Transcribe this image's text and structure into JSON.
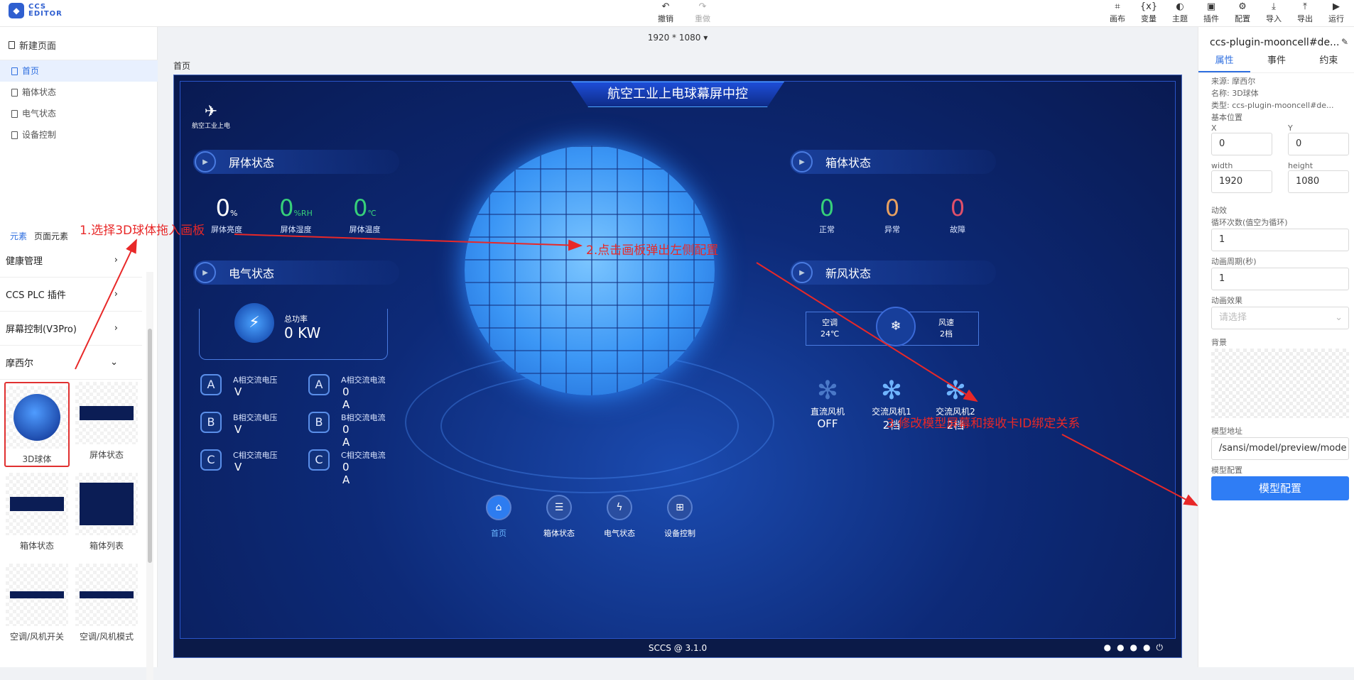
{
  "app": {
    "logo_line1": "CCS",
    "logo_line2": "EDITOR"
  },
  "toolbar": {
    "undo": "撤销",
    "redo": "重做",
    "tools": [
      "画布",
      "变量",
      "主题",
      "插件",
      "配置",
      "导入",
      "导出",
      "运行"
    ]
  },
  "left": {
    "new_page": "新建页面",
    "pages": [
      "首页",
      "箱体状态",
      "电气状态",
      "设备控制"
    ],
    "elem_tabs": [
      "元素",
      "页面元素"
    ],
    "categories": [
      "健康管理",
      "CCS PLC 插件",
      "屏幕控制(V3Pro)",
      "摩西尔"
    ],
    "components": [
      "3D球体",
      "屏体状态",
      "箱体状态",
      "箱体列表",
      "空调/风机开关",
      "空调/风机模式"
    ]
  },
  "center": {
    "resolution": "1920 * 1080",
    "breadcrumb": "首页",
    "footer": "SCCS @ 3.1.0"
  },
  "screen": {
    "title": "航空工业上电球幕屏中控",
    "brand": "航空工业上电",
    "sections": {
      "screen": "屏体状态",
      "electric": "电气状态",
      "box": "箱体状态",
      "fresh": "新风状态"
    },
    "screen_metrics": [
      {
        "value": "0",
        "unit": "%",
        "label": "屏体亮度"
      },
      {
        "value": "0",
        "unit": "%RH",
        "label": "屏体湿度"
      },
      {
        "value": "0",
        "unit": "℃",
        "label": "屏体温度"
      }
    ],
    "box_metrics": [
      {
        "value": "0",
        "label": "正常",
        "color": "#37d07a"
      },
      {
        "value": "0",
        "label": "异常",
        "color": "#e8a060"
      },
      {
        "value": "0",
        "label": "故障",
        "color": "#e0506a"
      }
    ],
    "power": {
      "label": "总功率",
      "value": "0 KW"
    },
    "phases": [
      {
        "tag": "A",
        "vlabel": "A相交流电压",
        "vval": "V",
        "clabel": "A相交流电流",
        "cval": "0 A"
      },
      {
        "tag": "B",
        "vlabel": "B相交流电压",
        "vval": "V",
        "clabel": "B相交流电流",
        "cval": "0 A"
      },
      {
        "tag": "C",
        "vlabel": "C相交流电压",
        "vval": "V",
        "clabel": "C相交流电流",
        "cval": "0 A"
      }
    ],
    "aircon": {
      "label": "空调",
      "temp": "24℃",
      "speed_label": "风速",
      "speed": "2档"
    },
    "fans": [
      {
        "label": "直流风机",
        "value": "OFF"
      },
      {
        "label": "交流风机1",
        "value": "2档"
      },
      {
        "label": "交流风机2",
        "value": "2档"
      }
    ],
    "nav": [
      "首页",
      "箱体状态",
      "电气状态",
      "设备控制"
    ]
  },
  "annotations": [
    "1.选择3D球体拖入画板",
    "2.点击画板弹出左侧配置",
    "3.修改模型屏幕和接收卡ID绑定关系"
  ],
  "right": {
    "title": "ccs-plugin-mooncell#de...",
    "tabs": [
      "属性",
      "事件",
      "约束"
    ],
    "source": "来源: 摩西尔",
    "name": "名称: 3D球体",
    "type": "类型: ccs-plugin-mooncell#de...",
    "basic_pos": "基本位置",
    "x_label": "X",
    "x": "0",
    "y_label": "Y",
    "y": "0",
    "w_label": "width",
    "w": "1920",
    "h_label": "height",
    "h": "1080",
    "anim": "动效",
    "loop_label": "循环次数(值空为循环)",
    "loop": "1",
    "period_label": "动画周期(秒)",
    "period": "1",
    "effect_label": "动画效果",
    "effect_placeholder": "请选择",
    "bg_label": "背景",
    "model_url_label": "模型地址",
    "model_url": "/sansi/model/preview/mode",
    "model_cfg_label": "模型配置",
    "model_cfg_btn": "模型配置"
  }
}
